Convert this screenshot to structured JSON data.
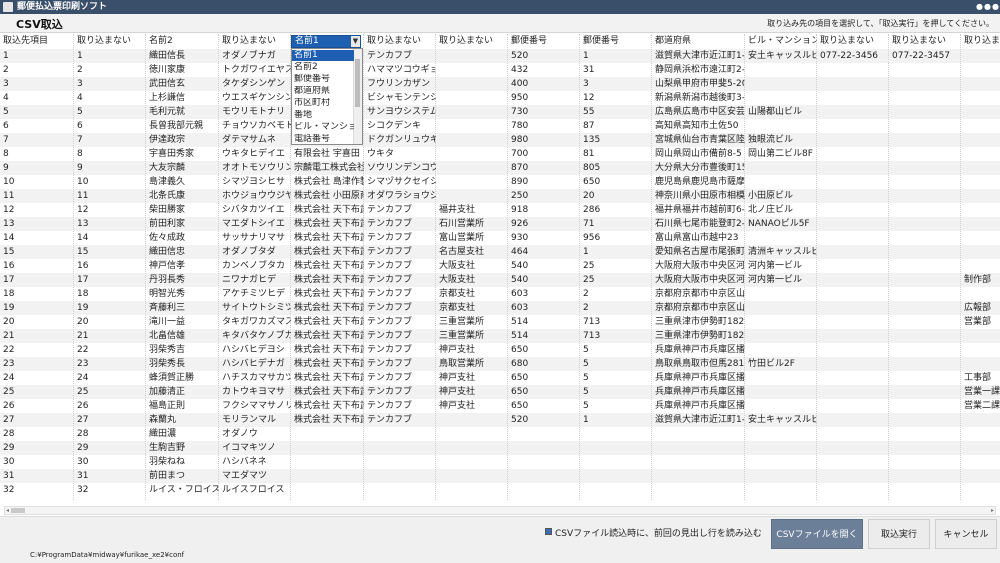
{
  "window": {
    "title": "郵便払込票印刷ソフト",
    "controls": [
      "minimize-icon",
      "maximize-icon",
      "close-icon"
    ]
  },
  "screen": {
    "title": "CSV取込",
    "hint": "取り込み先の項目を選択して、「取込実行」を押してください。"
  },
  "columns": [
    {
      "header": "取込先項目"
    },
    {
      "header": "取り込まない"
    },
    {
      "header": "名前2"
    },
    {
      "header": "取り込まない"
    },
    {
      "header": "名前1",
      "combo": true
    },
    {
      "header": "取り込まない"
    },
    {
      "header": "取り込まない"
    },
    {
      "header": "郵便番号"
    },
    {
      "header": "郵便番号"
    },
    {
      "header": "都道府県"
    },
    {
      "header": "ビル・マンション"
    },
    {
      "header": "取り込まない"
    },
    {
      "header": "取り込まない"
    },
    {
      "header": "取り込まない"
    }
  ],
  "combo": {
    "selected": "名前1",
    "options": [
      "名前1",
      "名前2",
      "郵便番号",
      "都道府県",
      "市区町村",
      "番地",
      "ビル・マンション",
      "電話番号"
    ]
  },
  "rows": [
    [
      "1",
      "1",
      "織田信長",
      "オダノブナガ",
      "",
      "テンカフブ",
      "",
      "520",
      "1",
      "滋賀県大津市近江町1-1",
      "安土キャッスルビ.",
      "077-22-3456",
      "077-22-3457",
      ""
    ],
    [
      "2",
      "2",
      "徳川家康",
      "トクガワイエヤス",
      "",
      "ハママツコウギョウ",
      "",
      "432",
      "31",
      "静岡県浜松市遠江町2-2",
      "",
      "",
      "",
      ""
    ],
    [
      "3",
      "3",
      "武田信玄",
      "タケダシンゲン",
      "",
      "フウリンカザン",
      "",
      "400",
      "3",
      "山梨県甲府市甲斐5-20",
      "",
      "",
      "",
      ""
    ],
    [
      "4",
      "4",
      "上杉謙信",
      "ウエスギケンシン",
      "",
      "ビシャモンテンシ",
      "",
      "950",
      "12",
      "新潟県新潟市越後町3-20",
      "",
      "",
      "",
      ""
    ],
    [
      "5",
      "5",
      "毛利元就",
      "モウリモトナリ",
      "",
      "サンヨウシステム",
      "",
      "730",
      "55",
      "広島県広島市中区安芸町",
      "山陽都山ビル",
      "",
      "",
      ""
    ],
    [
      "6",
      "6",
      "長曾我部元親",
      "チョウソカベモトチカ",
      "",
      "シコクデンキ",
      "",
      "780",
      "87",
      "高知県高知市土佐50",
      "",
      "",
      "",
      ""
    ],
    [
      "7",
      "7",
      "伊達政宗",
      "ダテマサムネ",
      "",
      "ドクガンリュウギ",
      "",
      "980",
      "135",
      "宮城県仙台市青葉区陸奥",
      "独眼流ビル",
      "",
      "",
      ""
    ],
    [
      "8",
      "8",
      "宇喜田秀家",
      "ウキタヒデイエ",
      "有限会社 宇喜田",
      "ウキタ",
      "",
      "700",
      "81",
      "岡山県岡山市備前8-5",
      "岡山第二ビル8F",
      "",
      "",
      ""
    ],
    [
      "9",
      "9",
      "大友宗麟",
      "オオトモソウリン",
      "宗麟電工株式会社",
      "ソウリンデンコウ",
      "",
      "870",
      "805",
      "大分県大分市豊後町15",
      "",
      "",
      "",
      ""
    ],
    [
      "10",
      "10",
      "島津義久",
      "シマヅヨシヒサ",
      "株式会社 島津作製",
      "シマヅサクセイショ",
      "",
      "890",
      "650",
      "鹿児島県鹿児島市薩摩4",
      "",
      "",
      "",
      ""
    ],
    [
      "11",
      "11",
      "北条氏康",
      "ホウジョウウジヤス",
      "株式会社 小田原商",
      "オダワラショウジ",
      "",
      "250",
      "20",
      "神奈川県小田原市相模1",
      "小田原ビル",
      "",
      "",
      ""
    ],
    [
      "12",
      "12",
      "柴田勝家",
      "シバタカツイエ",
      "株式会社 天下布武",
      "テンカフブ",
      "福井支社",
      "918",
      "286",
      "福井県福井市越前町6-3",
      "北ノ庄ビル",
      "",
      "",
      ""
    ],
    [
      "13",
      "13",
      "前田利家",
      "マエダトシイエ",
      "株式会社 天下布武",
      "テンカフブ",
      "石川営業所",
      "926",
      "71",
      "石川県七尾市能登町2-3",
      "NANAOビル5F",
      "",
      "",
      ""
    ],
    [
      "14",
      "14",
      "佐々成政",
      "サッサナリマサ",
      "株式会社 天下布武",
      "テンカフブ",
      "富山営業所",
      "930",
      "956",
      "富山県富山市越中23",
      "",
      "",
      "",
      ""
    ],
    [
      "15",
      "15",
      "織田信忠",
      "オダノブタダ",
      "株式会社 天下布武",
      "テンカフブ",
      "名古屋支社",
      "464",
      "1",
      "愛知県名古屋市尾張町1",
      "清洲キャッスルビ.",
      "",
      "",
      ""
    ],
    [
      "16",
      "16",
      "神戸信孝",
      "カンベノブタカ",
      "株式会社 天下布武",
      "テンカフブ",
      "大阪支社",
      "540",
      "25",
      "大阪府大阪市中央区河内",
      "河内第一ビル",
      "",
      "",
      ""
    ],
    [
      "17",
      "17",
      "丹羽長秀",
      "ニワナガヒデ",
      "株式会社 天下布武",
      "テンカフブ",
      "大阪支社",
      "540",
      "25",
      "大阪府大阪市中央区河内",
      "河内第一ビル",
      "",
      "",
      "制作部"
    ],
    [
      "18",
      "18",
      "明智光秀",
      "アケチミツヒデ",
      "株式会社 天下布武",
      "テンカフブ",
      "京都支社",
      "603",
      "2",
      "京都府京都市中京区山城",
      "",
      "",
      "",
      ""
    ],
    [
      "19",
      "19",
      "斉藤利三",
      "サイトウトシミツ",
      "株式会社 天下布武",
      "テンカフブ",
      "京都支社",
      "603",
      "2",
      "京都府京都市中京区山城",
      "",
      "",
      "",
      "広報部"
    ],
    [
      "20",
      "20",
      "滝川一益",
      "タキガワカズマス",
      "株式会社 天下布武",
      "テンカフブ",
      "三重営業所",
      "514",
      "713",
      "三重県津市伊勢町1825",
      "",
      "",
      "",
      "営業部"
    ],
    [
      "21",
      "21",
      "北畠信雄",
      "キタバタケノブカツ",
      "株式会社 天下布武",
      "テンカフブ",
      "三重営業所",
      "514",
      "713",
      "三重県津市伊勢町1825",
      "",
      "",
      "",
      ""
    ],
    [
      "22",
      "22",
      "羽柴秀吉",
      "ハシバヒデヨシ",
      "株式会社 天下布武",
      "テンカフブ",
      "神戸支社",
      "650",
      "5",
      "兵庫県神戸市兵庫区播磨",
      "",
      "",
      "",
      ""
    ],
    [
      "23",
      "23",
      "羽柴秀長",
      "ハシバヒデナガ",
      "株式会社 天下布武",
      "テンカフブ",
      "鳥取営業所",
      "680",
      "5",
      "鳥取県鳥取市但馬281",
      "竹田ビル2F",
      "",
      "",
      ""
    ],
    [
      "24",
      "24",
      "蜂須賀正勝",
      "ハチスカマサカツ",
      "株式会社 天下布武",
      "テンカフブ",
      "神戸支社",
      "650",
      "5",
      "兵庫県神戸市兵庫区播磨",
      "",
      "",
      "",
      "工事部"
    ],
    [
      "25",
      "25",
      "加藤清正",
      "カトウキヨマサ",
      "株式会社 天下布武",
      "テンカフブ",
      "神戸支社",
      "650",
      "5",
      "兵庫県神戸市兵庫区播磨",
      "",
      "",
      "",
      "営業一課"
    ],
    [
      "26",
      "26",
      "福島正則",
      "フクシママサノリ",
      "株式会社 天下布武",
      "テンカフブ",
      "神戸支社",
      "650",
      "5",
      "兵庫県神戸市兵庫区播磨",
      "",
      "",
      "",
      "営業二課"
    ],
    [
      "27",
      "27",
      "森蘭丸",
      "モリランマル",
      "株式会社 天下布武",
      "テンカフブ",
      "",
      "520",
      "1",
      "滋賀県大津市近江町1-1",
      "安土キャッスルビ.",
      "",
      "",
      ""
    ],
    [
      "28",
      "28",
      "織田濃",
      "オダノウ",
      "",
      "",
      "",
      "",
      "",
      "",
      "",
      "",
      "",
      ""
    ],
    [
      "29",
      "29",
      "生駒吉野",
      "イコマキツノ",
      "",
      "",
      "",
      "",
      "",
      "",
      "",
      "",
      "",
      ""
    ],
    [
      "30",
      "30",
      "羽柴ねね",
      "ハシバネネ",
      "",
      "",
      "",
      "",
      "",
      "",
      "",
      "",
      "",
      ""
    ],
    [
      "31",
      "31",
      "前田まつ",
      "マエダマツ",
      "",
      "",
      "",
      "",
      "",
      "",
      "",
      "",
      "",
      ""
    ],
    [
      "32",
      "32",
      "ルイス・フロイス",
      "ルイスフロイス",
      "",
      "",
      "",
      "",
      "",
      "",
      "",
      "",
      "",
      ""
    ]
  ],
  "footer": {
    "checkbox_label": "CSVファイル読込時に、前回の見出し行を読み込む",
    "checkbox_checked": true,
    "open_csv_label": "CSVファイルを開く",
    "import_label": "取込実行",
    "cancel_label": "キャンセル",
    "path": "C:¥ProgramData¥midway¥furikae_xe2¥conf"
  },
  "colors": {
    "titlebar": "#3a4f6a",
    "accent": "#1f5fb2",
    "primary_button": "#6b7f99",
    "stripe": "#f2f2f2"
  }
}
